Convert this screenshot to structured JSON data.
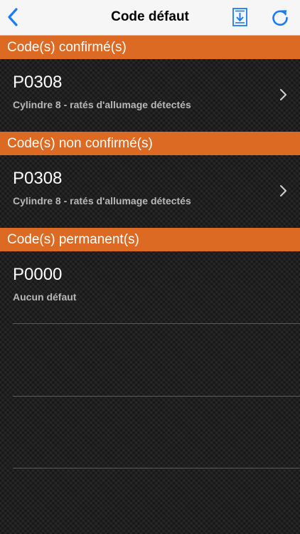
{
  "nav": {
    "title": "Code défaut",
    "back_icon": "chevron-left-icon",
    "save_icon": "download-document-icon",
    "refresh_icon": "refresh-icon"
  },
  "colors": {
    "accent": "#1a7cf5",
    "section_header": "#dd6a22"
  },
  "sections": [
    {
      "title": "Code(s) confirmé(s)",
      "rows": [
        {
          "code": "P0308",
          "description": "Cylindre 8 - ratés d'allumage détectés",
          "has_chevron": true
        }
      ]
    },
    {
      "title": "Code(s) non confirmé(s)",
      "rows": [
        {
          "code": "P0308",
          "description": "Cylindre 8 - ratés d'allumage détectés",
          "has_chevron": true
        }
      ]
    },
    {
      "title": "Code(s) permanent(s)",
      "rows": [
        {
          "code": "P0000",
          "description": "Aucun défaut",
          "has_chevron": false
        }
      ]
    }
  ]
}
